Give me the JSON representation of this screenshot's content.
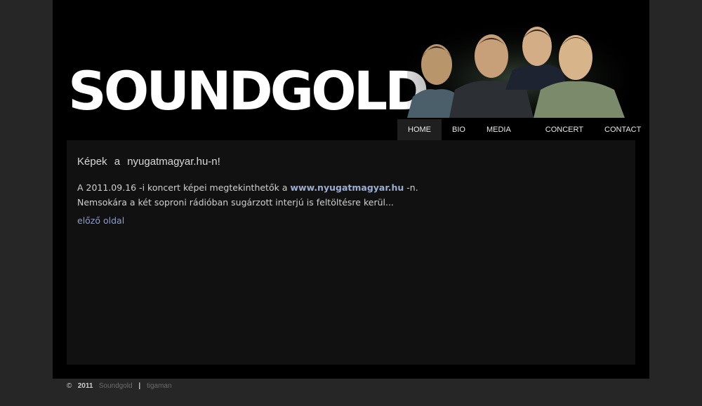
{
  "logo": {
    "text": "SOUNDGOLD"
  },
  "nav": {
    "home": "HOME",
    "bio": "BIO",
    "media": "MEDIA",
    "concert": "CONCERT",
    "contact": "CONTACT"
  },
  "article": {
    "title": "Képek  a  nyugatmagyar.hu-n!",
    "line1_prefix": "A 2011.09.16 -i koncert képei megtekinthetők a ",
    "line1_link": "www.nyugatmagyar.hu",
    "line1_suffix": " -n.",
    "line2": "Nemsokára a két soproni rádióban sugárzott interjú is feltöltésre kerül...",
    "back_link": "előző oldal"
  },
  "footer": {
    "copyright": "©",
    "year": "2011",
    "brand": "Soundgold",
    "separator": "|",
    "author": "tigaman"
  },
  "colors": {
    "page_bg": "#262626",
    "frame_bg": "#000000",
    "content_bg": "#111111",
    "link": "#9aaed4"
  }
}
